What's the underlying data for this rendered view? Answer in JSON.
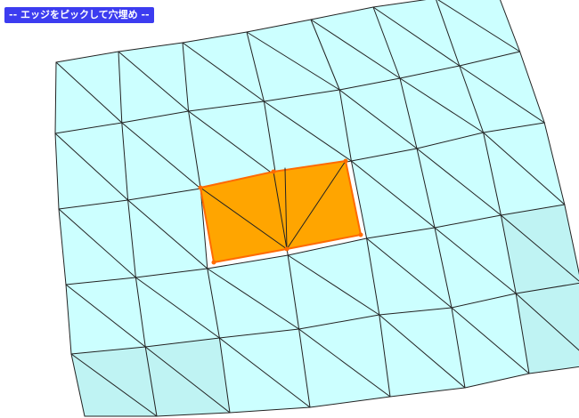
{
  "mode_label": "-- エッジをピックして穴埋め --",
  "colors": {
    "mesh_fill": "#ccffff",
    "mesh_edge": "#222222",
    "hole_fill": "#ffa500",
    "hole_edge": "#ff6a00",
    "label_bg": "#3c3cf0",
    "label_text": "#ffffff"
  }
}
